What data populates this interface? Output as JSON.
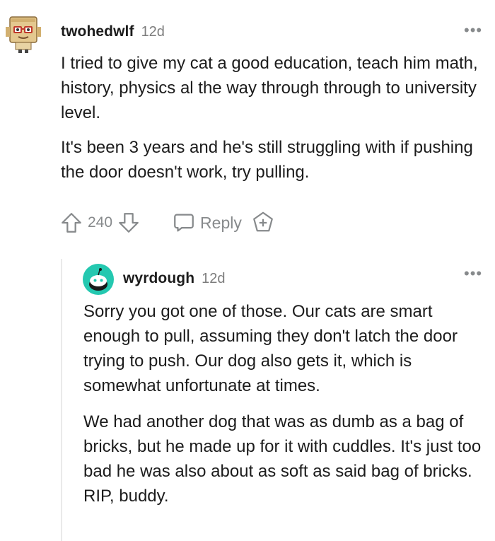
{
  "comments": [
    {
      "username": "twohedwlf",
      "age": "12d",
      "avatar": "boxy-robot-avatar",
      "paragraphs": [
        "I tried to give my cat a good education, teach him math, history, physics al the way through through to university level.",
        "It's been 3 years and he's still struggling with if pushing the door doesn't work, try pulling."
      ],
      "votes": "240",
      "reply_label": "Reply"
    },
    {
      "username": "wyrdough",
      "age": "12d",
      "avatar": "teal-snoo-avatar",
      "paragraphs": [
        "Sorry you got one of those. Our cats are smart enough to pull, assuming they don't latch the door trying to push. Our dog also gets it, which is somewhat unfortunate at times.",
        "We had another dog that was as dumb as a bag of bricks, but he made up for it with cuddles. It's just too bad he was also about as soft as said bag of bricks. RIP, buddy."
      ]
    }
  ],
  "more_options_glyph": "•••",
  "colors": {
    "text": "#1c1c1c",
    "meta": "#7c7c7c",
    "icon": "#878a8c",
    "thread_line": "#eaeaea",
    "avatar_teal": "#24c8b0"
  },
  "icons": [
    "upvote-icon",
    "downvote-icon",
    "reply-bubble-icon",
    "award-plus-icon",
    "more-options-icon"
  ]
}
